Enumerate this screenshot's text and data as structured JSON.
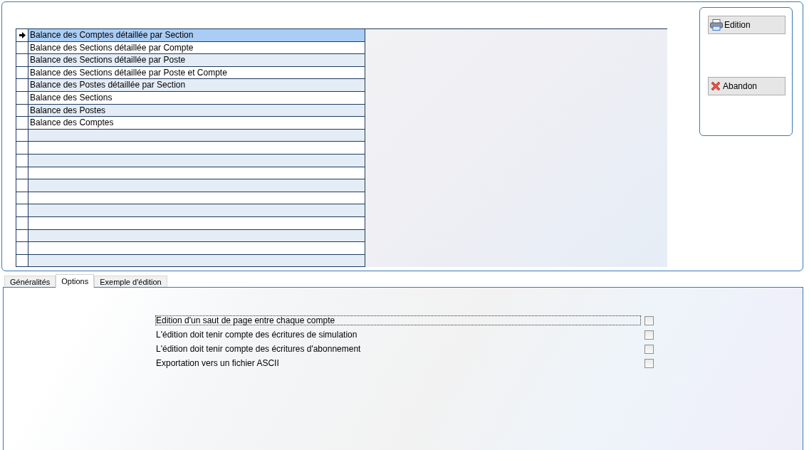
{
  "reports": [
    {
      "label": "Balance des Comptes détaillée par Section",
      "selected": true
    },
    {
      "label": "Balance des Sections détaillée par Compte",
      "selected": false
    },
    {
      "label": "Balance des Sections détaillée par Poste",
      "selected": false
    },
    {
      "label": "Balance des Sections détaillée par Poste et Compte",
      "selected": false
    },
    {
      "label": "Balance des Postes détaillée par Section",
      "selected": false
    },
    {
      "label": "Balance des Sections",
      "selected": false
    },
    {
      "label": "Balance des Postes",
      "selected": false
    },
    {
      "label": "Balance des Comptes",
      "selected": false
    }
  ],
  "buttons": [
    {
      "kind": "print",
      "label": "Edition"
    },
    {
      "kind": "cancel",
      "label": "Abandon"
    }
  ],
  "tabs": [
    {
      "label": "Généralités",
      "selected": false
    },
    {
      "label": "Options",
      "selected": true
    },
    {
      "label": "Exemple d'édition",
      "selected": false
    }
  ],
  "options": [
    {
      "label": "Edition d'un saut de page entre chaque compte",
      "checked": false,
      "focused": true
    },
    {
      "label": "L'édition doit tenir compte des écritures de simulation",
      "checked": false,
      "focused": false
    },
    {
      "label": "L'édition doit tenir compte des écritures d'abonnement",
      "checked": false,
      "focused": false
    },
    {
      "label": "Exportation vers un fichier ASCII",
      "checked": false,
      "focused": false
    }
  ]
}
